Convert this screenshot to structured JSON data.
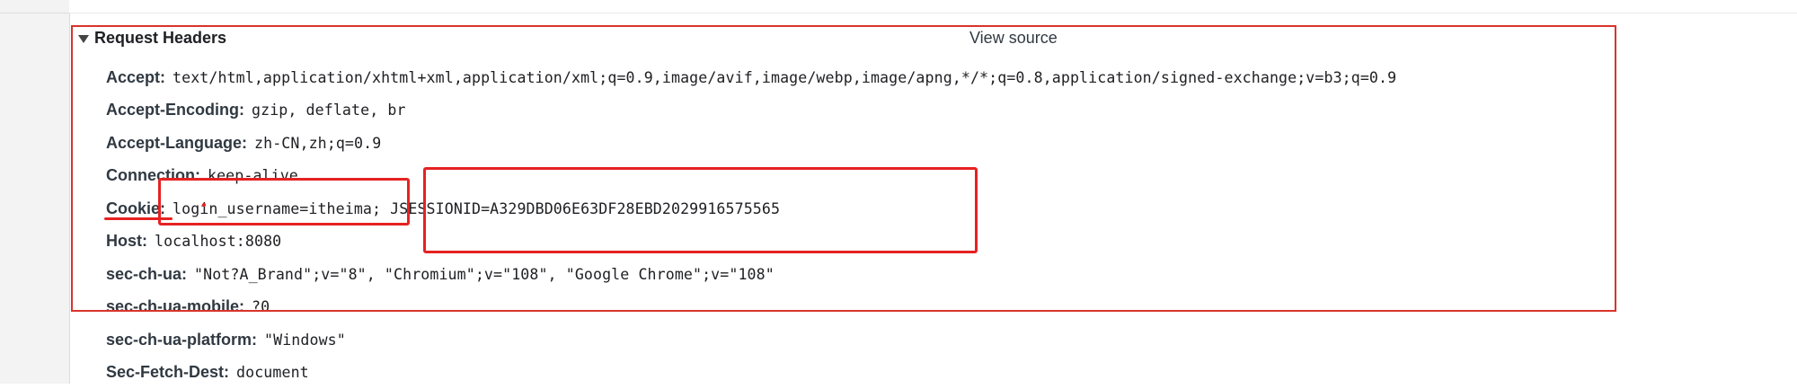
{
  "section": {
    "title": "Request Headers",
    "view_source": "View source",
    "expanded_icon": "triangle-down-icon"
  },
  "headers": [
    {
      "key": "Accept:",
      "value": "text/html,application/xhtml+xml,application/xml;q=0.9,image/avif,image/webp,image/apng,*/*;q=0.8,application/signed-exchange;v=b3;q=0.9"
    },
    {
      "key": "Accept-Encoding:",
      "value": "gzip, deflate, br"
    },
    {
      "key": "Accept-Language:",
      "value": "zh-CN,zh;q=0.9"
    },
    {
      "key": "Connection:",
      "value": "keep-alive"
    },
    {
      "key": "Cookie:",
      "value": "login_username=itheima; JSESSIONID=A329DBD06E63DF28EBD2029916575565"
    },
    {
      "key": "Host:",
      "value": "localhost:8080"
    },
    {
      "key": "sec-ch-ua:",
      "value": "\"Not?A_Brand\";v=\"8\", \"Chromium\";v=\"108\", \"Google Chrome\";v=\"108\""
    },
    {
      "key": "sec-ch-ua-mobile:",
      "value": "?0"
    },
    {
      "key": "sec-ch-ua-platform:",
      "value": "\"Windows\""
    },
    {
      "key": "Sec-Fetch-Dest:",
      "value": "document"
    }
  ],
  "colors": {
    "annotation_red": "#e62222",
    "section_outline": "#d9342b"
  }
}
